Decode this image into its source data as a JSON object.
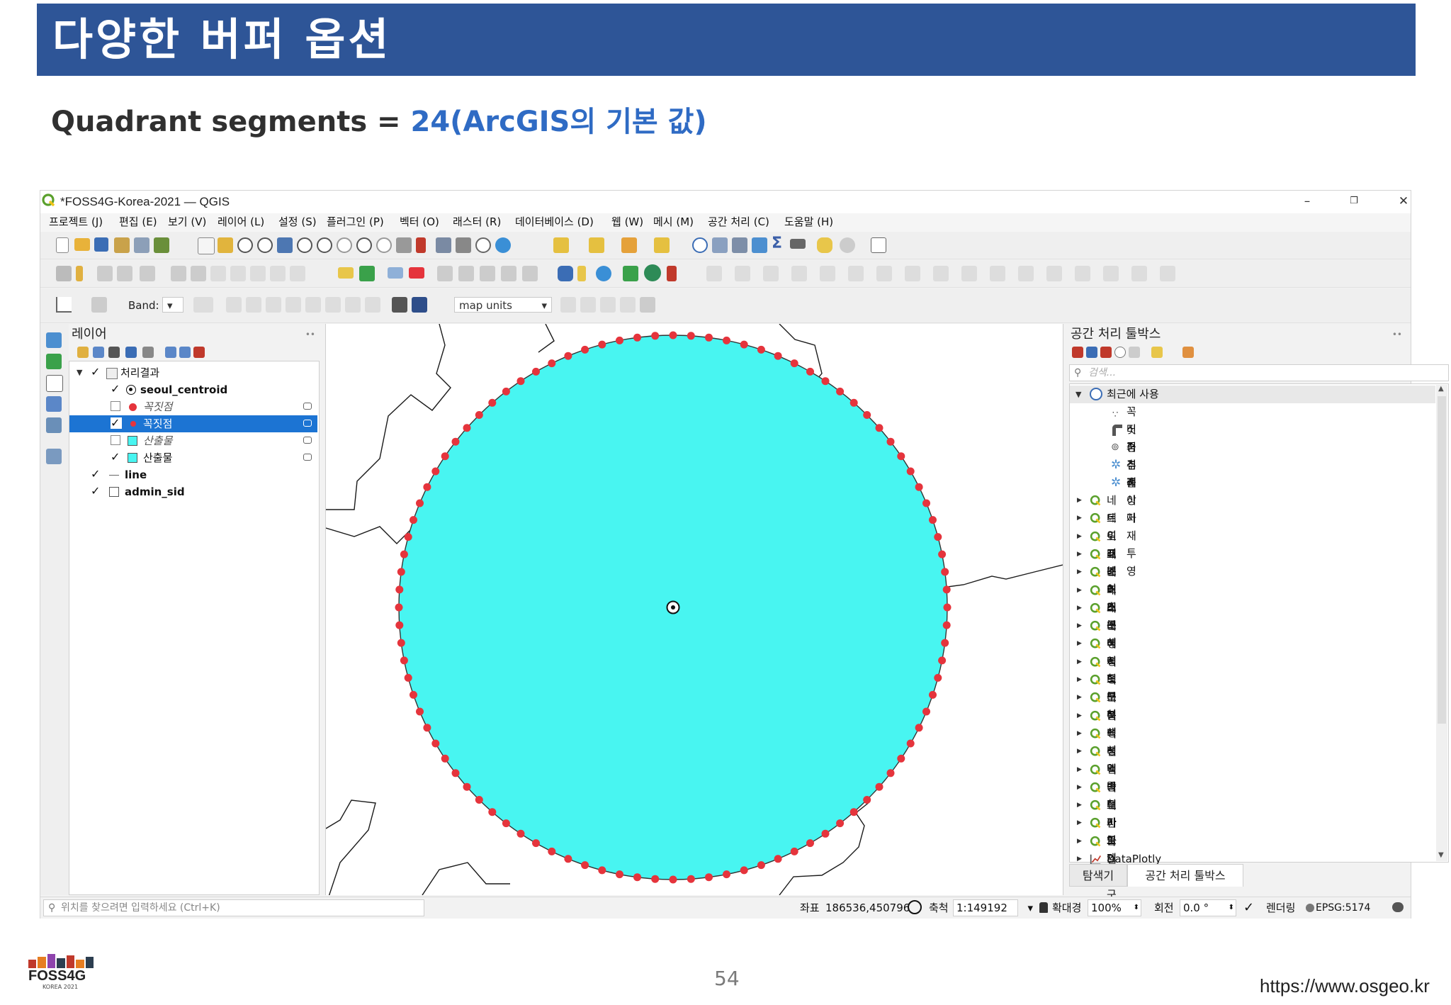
{
  "slide": {
    "title": "다양한 버퍼 옵션",
    "subtitle_main": "Quadrant segments = ",
    "subtitle_accent": "24(ArcGIS의 기본 값)",
    "page_number": "54",
    "url": "https://www.osgeo.kr",
    "logo_text": "FOSS4G",
    "logo_subtext": "KOREA 2021"
  },
  "window": {
    "title": "*FOSS4G-Korea-2021 — QGIS",
    "minimize": "–",
    "restore": "❐",
    "close": "✕"
  },
  "menu": [
    "프로젝트 (J)",
    "편집 (E)",
    "보기 (V)",
    "레이어 (L)",
    "설정 (S)",
    "플러그인 (P)",
    "벡터 (O)",
    "래스터 (R)",
    "데이터베이스 (D)",
    "웹 (W)",
    "메시 (M)",
    "공간 처리 (C)",
    "도움말 (H)"
  ],
  "toolbar": {
    "band_label": "Band:",
    "map_units": "map units"
  },
  "layers_panel": {
    "title": "레이어",
    "items": [
      {
        "label": "처리결과",
        "level": 0,
        "checked": true,
        "group": true
      },
      {
        "label": "seoul_centroid",
        "level": 1,
        "checked": true
      },
      {
        "label": "꼭짓점",
        "level": 1,
        "checked": false,
        "italic": true
      },
      {
        "label": "꼭짓점",
        "level": 1,
        "checked": true,
        "selected": true
      },
      {
        "label": "산출물",
        "level": 1,
        "checked": false,
        "italic": true
      },
      {
        "label": "산출물",
        "level": 1,
        "checked": true
      },
      {
        "label": "line",
        "level": 0,
        "checked": true
      },
      {
        "label": "admin_sid",
        "level": 0,
        "checked": true
      }
    ]
  },
  "processing_panel": {
    "title": "공간 처리 툴박스",
    "search_placeholder": "검색...",
    "recent_label": "최근에 사용",
    "recent_items": [
      "꼭짓점 추출",
      "버퍼",
      "중심점",
      "경계 상자",
      "레이어 재투영"
    ],
    "groups": [
      "네트워크 분석",
      "데이터베이스",
      "도표",
      "래스터 도구",
      "래스터 분석",
      "래스터 생성",
      "래스터 지형 분석",
      "레이어 도구",
      "메시",
      "벡터 도형",
      "벡터 분석",
      "벡터 생성",
      "벡터 선택",
      "벡터 일반",
      "벡터 중첩",
      "벡터 테이블",
      "벡터 파일",
      "보간",
      "지도 제작",
      "파일 도구",
      "DataPlotly"
    ],
    "tab_browser": "탐색기",
    "tab_toolbox": "공간 처리 툴박스"
  },
  "map": {
    "buffer_fill": "#48f5f1",
    "vertex_color": "#e5343c",
    "vertex_count": 96
  },
  "status": {
    "locator_placeholder": "위치를 찾으려면 입력하세요 (Ctrl+K)",
    "coord_label": "좌표",
    "coord_value": "186536,450796",
    "scale_label": "축척",
    "scale_value": "1:149192",
    "magnifier_label": "확대경",
    "magnifier_value": "100%",
    "rotation_label": "회전",
    "rotation_value": "0.0 °",
    "render_label": "렌더링",
    "crs": "EPSG:5174"
  },
  "colors": {
    "banner": "#2e5597",
    "accent": "#2f6bc4",
    "selection": "#1c74d3"
  }
}
